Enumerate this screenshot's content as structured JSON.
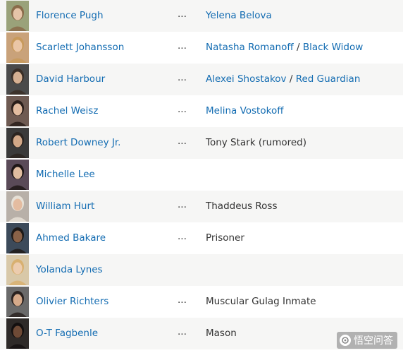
{
  "cast": [
    {
      "actor": "Florence Pugh",
      "ellipsis": "...",
      "character_parts": [
        {
          "text": "Yelena Belova",
          "link": true
        }
      ],
      "photo": {
        "bg": "#9aa27a",
        "skin": "#e6c4a8",
        "hair": "#8a6b4a"
      }
    },
    {
      "actor": "Scarlett Johansson",
      "ellipsis": "...",
      "character_parts": [
        {
          "text": "Natasha Romanoff",
          "link": true
        },
        {
          "text": " / ",
          "link": false
        },
        {
          "text": "Black Widow",
          "link": true
        }
      ],
      "photo": {
        "bg": "#c9a27a",
        "skin": "#eac6a6",
        "hair": "#c89a5c"
      }
    },
    {
      "actor": "David Harbour",
      "ellipsis": "...",
      "character_parts": [
        {
          "text": "Alexei Shostakov",
          "link": true
        },
        {
          "text": " / ",
          "link": false
        },
        {
          "text": "Red Guardian",
          "link": true
        }
      ],
      "photo": {
        "bg": "#4a4a4a",
        "skin": "#d6b092",
        "hair": "#3a2e26"
      }
    },
    {
      "actor": "Rachel Weisz",
      "ellipsis": "...",
      "character_parts": [
        {
          "text": "Melina Vostokoff",
          "link": true
        }
      ],
      "photo": {
        "bg": "#6e5a52",
        "skin": "#e2bca0",
        "hair": "#2a1e1a"
      }
    },
    {
      "actor": "Robert Downey Jr.",
      "ellipsis": "...",
      "character_parts": [
        {
          "text": "Tony Stark (rumored)",
          "link": false
        }
      ],
      "photo": {
        "bg": "#3a3a3a",
        "skin": "#d2a888",
        "hair": "#2b2420"
      }
    },
    {
      "actor": "Michelle Lee",
      "ellipsis": "",
      "character_parts": [],
      "photo": {
        "bg": "#5a4a58",
        "skin": "#e0bca0",
        "hair": "#1e1616"
      }
    },
    {
      "actor": "William Hurt",
      "ellipsis": "...",
      "character_parts": [
        {
          "text": "Thaddeus Ross",
          "link": false
        }
      ],
      "photo": {
        "bg": "#b8b0a8",
        "skin": "#e4bca0",
        "hair": "#e6e0d6"
      }
    },
    {
      "actor": "Ahmed Bakare",
      "ellipsis": "...",
      "character_parts": [
        {
          "text": "Prisoner",
          "link": false
        }
      ],
      "photo": {
        "bg": "#3c4a5a",
        "skin": "#8a6248",
        "hair": "#1e1a18"
      }
    },
    {
      "actor": "Yolanda Lynes",
      "ellipsis": "",
      "character_parts": [],
      "photo": {
        "bg": "#d8c8a8",
        "skin": "#ecccae",
        "hair": "#d8b070"
      }
    },
    {
      "actor": "Olivier Richters",
      "ellipsis": "...",
      "character_parts": [
        {
          "text": "Muscular Gulag Inmate",
          "link": false
        }
      ],
      "photo": {
        "bg": "#6a6a6a",
        "skin": "#d6aa8a",
        "hair": "#2a2220"
      }
    },
    {
      "actor": "O-T Fagbenle",
      "ellipsis": "...",
      "character_parts": [
        {
          "text": "Mason",
          "link": false
        }
      ],
      "photo": {
        "bg": "#2e2a28",
        "skin": "#6e4a36",
        "hair": "#141010"
      }
    }
  ],
  "watermark": {
    "text": "悟空问答"
  },
  "colors": {
    "link": "#136cb2",
    "row_alt": "#f6f6f5",
    "text": "#333333"
  }
}
